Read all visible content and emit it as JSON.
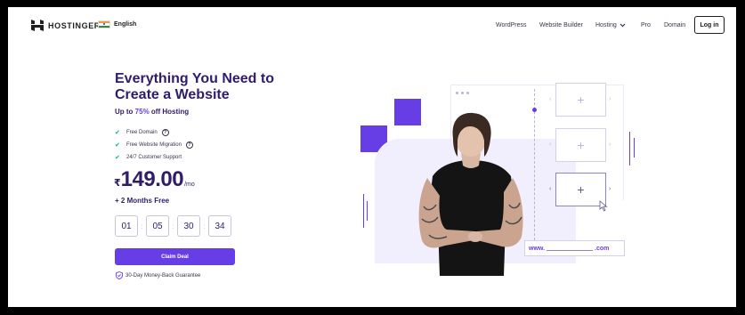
{
  "header": {
    "brand": "HOSTINGER",
    "language": "English",
    "nav": [
      "WordPress",
      "Website Builder",
      "Hosting",
      "Pro",
      "Domain"
    ],
    "login_label": "Log in"
  },
  "hero": {
    "title_line1": "Everything You Need to",
    "title_line2": "Create a Website",
    "promo_prefix": "Up to ",
    "promo_accent": "75%",
    "promo_suffix": " off Hosting",
    "features": [
      "Free Domain",
      "Free Website Migration",
      "24/7 Customer Support"
    ],
    "currency": "₹",
    "price": "149.00",
    "period": "/mo",
    "bonus": "+ 2 Months Free",
    "timer": [
      "01",
      "05",
      "30",
      "34"
    ],
    "cta_label": "Claim Deal",
    "guarantee": "30-Day Money-Back Guarantee"
  },
  "illustration": {
    "url_prefix": "www.",
    "url_suffix": ".com",
    "plus_glyph": "+"
  },
  "colors": {
    "accent": "#673de6",
    "heading": "#2f1c6a",
    "check": "#00b090",
    "background": "#ffffff",
    "frame": "#000000"
  },
  "icons": [
    "hostinger-logo-icon",
    "india-flag-icon",
    "chevron-down-icon",
    "check-icon",
    "help-icon",
    "shield-icon",
    "cursor-icon",
    "plus-icon"
  ]
}
